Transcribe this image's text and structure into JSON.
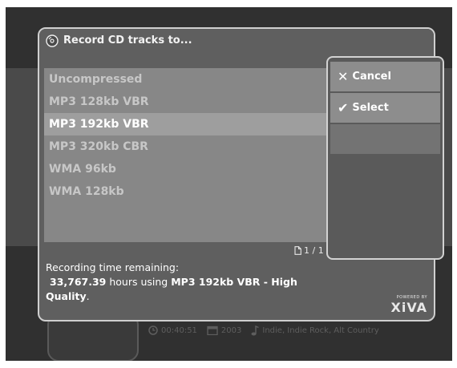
{
  "dialog": {
    "title": "Record CD tracks to...",
    "icon": "cd-icon"
  },
  "formats": [
    {
      "label": "Uncompressed",
      "selected": false
    },
    {
      "label": "MP3 128kb VBR",
      "selected": false
    },
    {
      "label": "MP3 192kb VBR",
      "selected": true
    },
    {
      "label": "MP3 320kb CBR",
      "selected": false
    },
    {
      "label": "WMA 96kb",
      "selected": false
    },
    {
      "label": "WMA 128kb",
      "selected": false
    }
  ],
  "pagination": {
    "text": "1 / 1",
    "icon": "page-icon"
  },
  "info": {
    "line1": "Recording time remaining:",
    "hours": "33,767.39",
    "hours_text": " hours using ",
    "format_bold": "MP3 192kb VBR - High",
    "quality_bold": "Quality",
    "period": "."
  },
  "branding": {
    "powered_by": "POWERED BY",
    "brand": "XiVA"
  },
  "menu": {
    "cancel_label": "Cancel",
    "cancel_icon": "x-icon",
    "select_label": "Select",
    "select_icon": "checkmark-icon"
  },
  "background": {
    "duration": "00:40:51",
    "year": "2003",
    "genre": "Indie, Indie Rock, Alt Country"
  },
  "colors": {
    "screen_bg": "#303030",
    "dialog_bg": "#5f5f5f",
    "list_bg": "#878787",
    "selected_row": "#9e9e9e",
    "menu_item_bg": "#8d8d8d",
    "border": "#cfcfcf"
  }
}
